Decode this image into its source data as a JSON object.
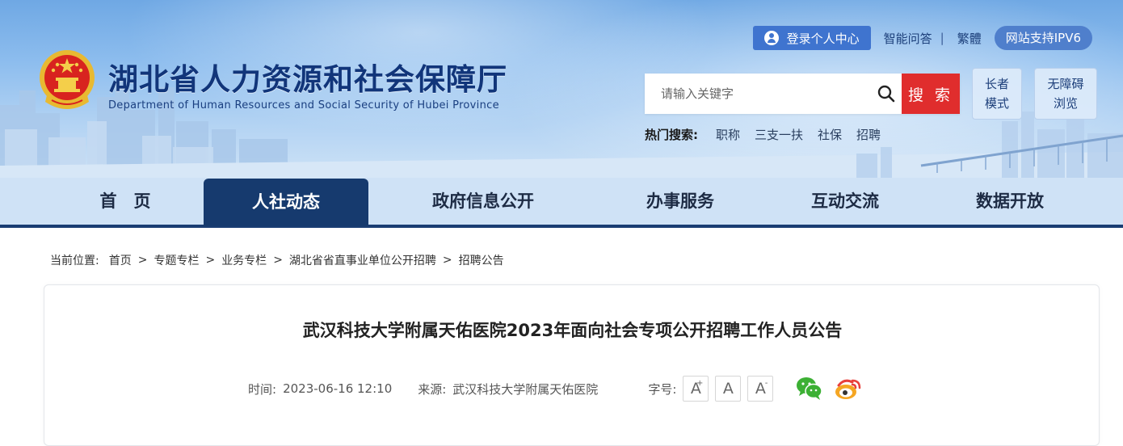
{
  "header": {
    "title": "湖北省人力资源和社会保障厅",
    "subtitle": "Department of Human Resources and Social Security of Hubei Province",
    "login_label": "登录个人中心",
    "qa_label": "智能问答",
    "separator": "|",
    "traditional_label": "繁體",
    "ipv6_label": "网站支持IPV6",
    "search_placeholder": "请输入关键字",
    "search_button": "搜 索",
    "elder_mode_line1": "长者",
    "elder_mode_line2": "模式",
    "accessible_line1": "无障碍",
    "accessible_line2": "浏览",
    "hot_label": "热门搜索:",
    "hot_items": [
      "职称",
      "三支一扶",
      "社保",
      "招聘"
    ]
  },
  "nav": {
    "items": [
      "首　页",
      "人社动态",
      "政府信息公开",
      "办事服务",
      "互动交流",
      "数据开放"
    ],
    "active_index": 1
  },
  "breadcrumb": {
    "label": "当前位置:",
    "items": [
      "首页",
      "专题专栏",
      "业务专栏",
      "湖北省省直事业单位公开招聘",
      "招聘公告"
    ],
    "separator": ">"
  },
  "article": {
    "title": "武汉科技大学附属天佑医院2023年面向社会专项公开招聘工作人员公告",
    "time_label": "时间:",
    "time_value": "2023-06-16 12:10",
    "source_label": "来源:",
    "source_value": "武汉科技大学附属天佑医院",
    "font_size_label": "字号:",
    "font_buttons": [
      "A",
      "A",
      "A"
    ],
    "font_button_marks": [
      "+",
      "",
      "-"
    ]
  },
  "colors": {
    "title_blue": "#11357a",
    "nav_active": "#163a6e",
    "search_red": "#e02d2d",
    "wechat_green": "#3cb034",
    "weibo_orange": "#f5a623"
  }
}
